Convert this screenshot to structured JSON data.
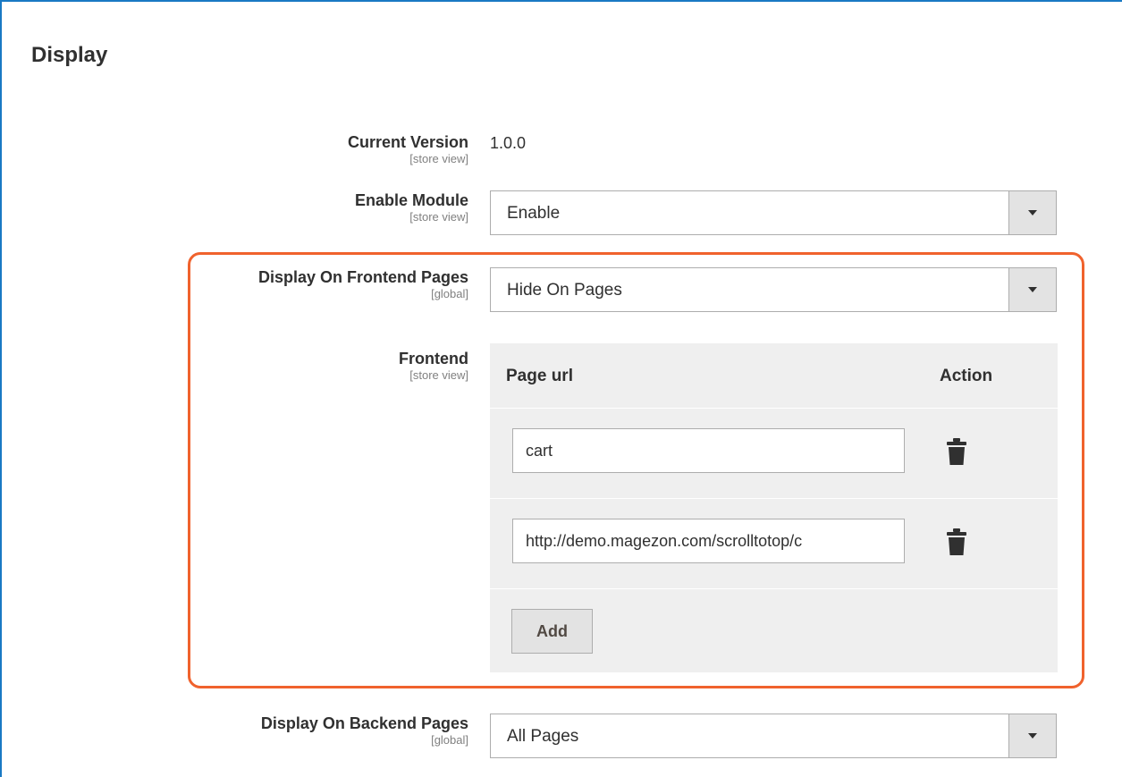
{
  "section": {
    "title": "Display"
  },
  "fields": {
    "current_version": {
      "label": "Current Version",
      "scope": "[store view]",
      "value": "1.0.0"
    },
    "enable_module": {
      "label": "Enable Module",
      "scope": "[store view]",
      "selected": "Enable"
    },
    "display_frontend": {
      "label": "Display On Frontend Pages",
      "scope": "[global]",
      "selected": "Hide On Pages"
    },
    "frontend": {
      "label": "Frontend",
      "scope": "[store view]",
      "grid": {
        "col_page_url": "Page url",
        "col_action": "Action",
        "rows": [
          {
            "page_url": "cart"
          },
          {
            "page_url": "http://demo.magezon.com/scrolltotop/c"
          }
        ],
        "add_label": "Add"
      }
    },
    "display_backend": {
      "label": "Display On Backend Pages",
      "scope": "[global]",
      "selected": "All Pages"
    }
  },
  "colors": {
    "accent_border": "#1979c3",
    "highlight": "#f0622d"
  },
  "icons": {
    "delete": "trash-icon",
    "dropdown": "chevron-down-icon"
  }
}
